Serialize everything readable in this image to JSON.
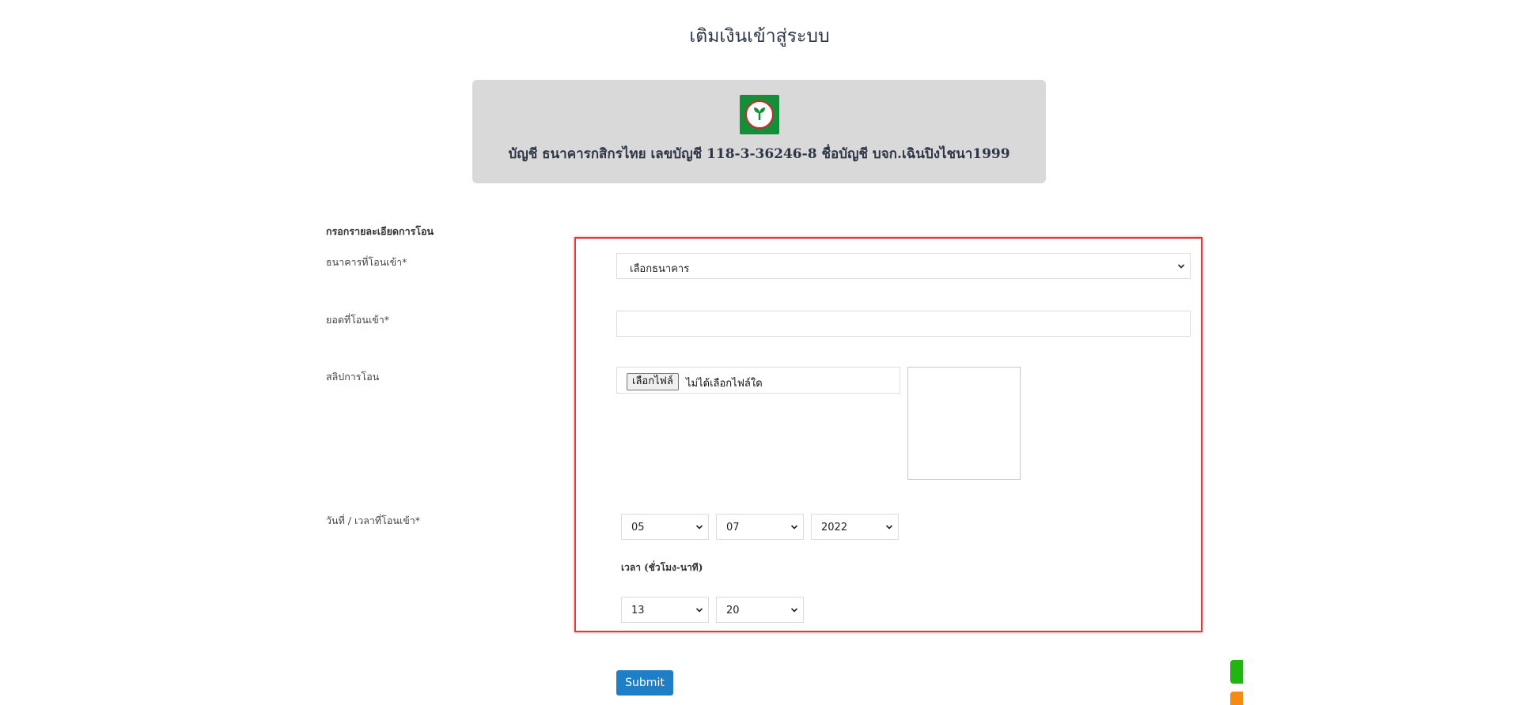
{
  "page": {
    "title": "เติมเงินเข้าสู่ระบบ"
  },
  "bank": {
    "logo_icon": "kasikorn-bank-logo-icon",
    "info": "บัญชี ธนาคารกสิกรไทย เลขบัญชี 118-3-36246-8 ชื่อบัญชี บจก.เฉินปิงไชนา1999"
  },
  "form": {
    "section_label": "กรอกรายละเอียดการโอน",
    "bank_label": "ธนาคารที่โอนเข้า*",
    "bank_select_value": "เลือกธนาคาร",
    "amount_label": "ยอดที่โอนเข้า*",
    "amount_value": "",
    "slip_label": "สลิปการโอน",
    "file_button": "เลือกไฟล์",
    "file_status": "ไม่ได้เลือกไฟล์ใด",
    "datetime_label": "วันที่ / เวลาที่โอนเข้า*",
    "day": "05",
    "month": "07",
    "year": "2022",
    "time_label": "เวลา (ชั่วโมง-นาที)",
    "hour": "13",
    "minute": "20",
    "submit_label": "Submit"
  },
  "colors": {
    "highlight_border": "#e03a3a",
    "submit_bg": "#1f7fc6",
    "float_green": "#22b512",
    "float_orange": "#f68b13",
    "bank_green": "#138f3a"
  }
}
